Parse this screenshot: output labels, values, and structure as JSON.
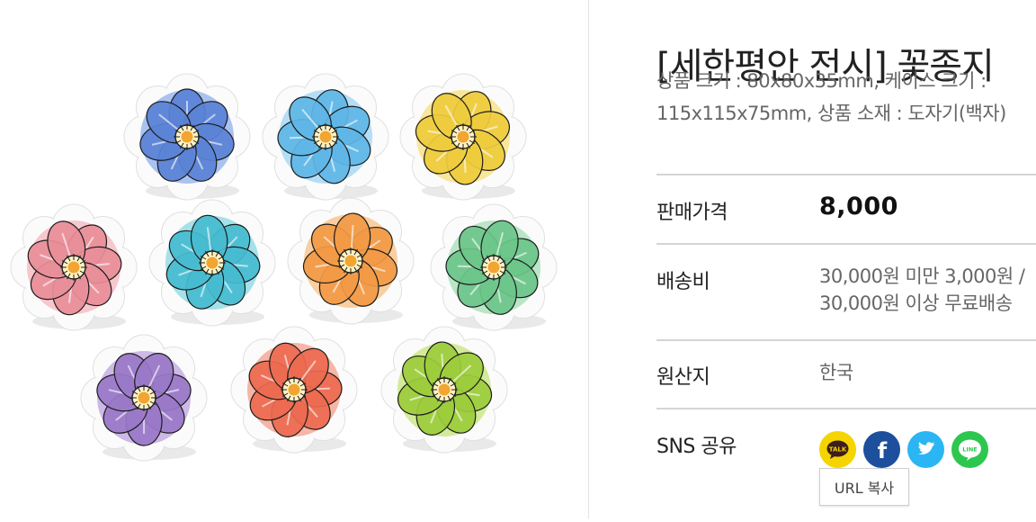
{
  "product": {
    "title": "[세한평안 전시] 꽃종지",
    "desc_line1": "상품 크기 : 80x80x35mm, 케이스 크기 :",
    "desc_line2": "115x115x75mm, 상품 소재 : 도자기(백자)"
  },
  "info": {
    "price_label": "판매가격",
    "price_value": "8,000",
    "shipping_label": "배송비",
    "shipping_line1": "30,000원 미만 3,000원 /",
    "shipping_line2": "30,000원 이상 무료배송",
    "origin_label": "원산지",
    "origin_value": "한국",
    "sns_label": "SNS 공유"
  },
  "sns": {
    "buttons": [
      {
        "name": "kakaotalk-share-icon",
        "text": "TALK",
        "color": "#f5d400"
      },
      {
        "name": "facebook-share-icon",
        "text": "f",
        "color": "#1d4f9c"
      },
      {
        "name": "twitter-share-icon",
        "text": "",
        "color": "#2bb6f3"
      },
      {
        "name": "line-share-icon",
        "text": "LINE",
        "color": "#2dc74f"
      }
    ],
    "url_copy_label": "URL 복사"
  },
  "dishes": [
    {
      "color": "#5b82d6",
      "light": "#a9c2f0"
    },
    {
      "color": "#5fb6e6",
      "light": "#b4def5"
    },
    {
      "color": "#efcc3d",
      "light": "#f8e79a"
    },
    {
      "color": "#e88e99",
      "light": "#f6c7cd"
    },
    {
      "color": "#47bcd0",
      "light": "#a6e1ea"
    },
    {
      "color": "#f29a45",
      "light": "#f9cfa1"
    },
    {
      "color": "#6cc58a",
      "light": "#b9e6c6"
    },
    {
      "color": "#9a78c8",
      "light": "#cdb9e6"
    },
    {
      "color": "#ec6a50",
      "light": "#f6b5a6"
    },
    {
      "color": "#9ccc3c",
      "light": "#d3ea9a"
    }
  ]
}
